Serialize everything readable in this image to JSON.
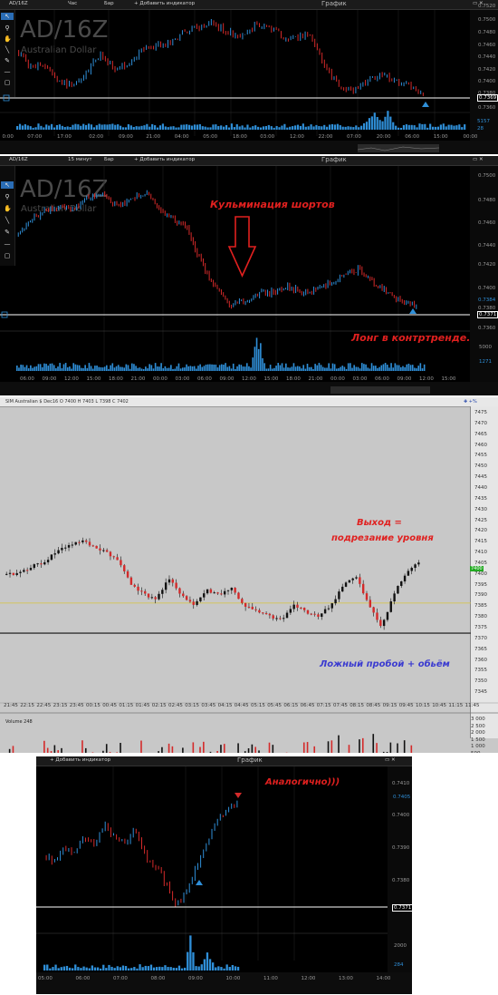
{
  "panel1": {
    "symbol_tab": "AD/16Z",
    "timeframe": "Час",
    "chart_type": "Бар",
    "add_indicator": "+ Добавить индикатор",
    "window_title": "График",
    "symbol_big": "AD/16Z",
    "instrument_name": "Australian Dollar",
    "price_axis": [
      "0.7520",
      "0.7500",
      "0.7480",
      "0.7460",
      "0.7440",
      "0.7420",
      "0.7400",
      "0.7380",
      "0.7369",
      "0.7360"
    ],
    "current_price": "0.7369",
    "volume_labels": [
      "5157",
      "28"
    ],
    "time_axis": [
      "0:00",
      "07:00",
      "17:00",
      "02:00",
      "09:00",
      "21:00",
      "04:00",
      "05:00",
      "18:00",
      "03:00",
      "12:00",
      "22:00",
      "07:00",
      "20:00",
      "06:00",
      "15:00",
      "00:00"
    ]
  },
  "panel2": {
    "symbol_tab": "AD/16Z",
    "timeframe": "15 минут",
    "chart_type": "Бар",
    "add_indicator": "+ Добавить индикатор",
    "window_title": "График",
    "symbol_big": "AD/16Z",
    "instrument_name": "Australian Dollar",
    "price_axis": [
      "0.7500",
      "0.7480",
      "0.7460",
      "0.7440",
      "0.7420",
      "0.7400",
      "0.7384",
      "0.7380",
      "0.7371",
      "0.7360"
    ],
    "current_price": "0.7371",
    "volume_labels": [
      "5000",
      "1271"
    ],
    "time_axis": [
      "06:00",
      "09:00",
      "12:00",
      "15:00",
      "18:00",
      "21:00",
      "00:00",
      "03:00",
      "06:00",
      "09:00",
      "12:00",
      "15:00",
      "18:00",
      "21:00",
      "00:00",
      "03:00",
      "06:00",
      "09:00",
      "12:00",
      "15:00"
    ],
    "annotation_top": "Кульминация шортов",
    "annotation_bottom": "Лонг в контртренде."
  },
  "panel3": {
    "header_text": "SIM Australian $ Dec16 O 7400 H 7403 L 7398 C 7402",
    "price_axis": [
      "7475",
      "7470",
      "7465",
      "7460",
      "7455",
      "7450",
      "7445",
      "7440",
      "7435",
      "7430",
      "7425",
      "7420",
      "7415",
      "7410",
      "7405",
      "7400",
      "7395",
      "7390",
      "7385",
      "7380",
      "7375",
      "7370",
      "7365",
      "7360",
      "7355",
      "7350",
      "7345"
    ],
    "current_price": "7400",
    "time_axis": [
      "21:45",
      "22:15",
      "22:45",
      "23:15",
      "23:45",
      "00:15",
      "00:45",
      "01:15",
      "01:45",
      "02:15",
      "02:45",
      "03:15",
      "03:45",
      "04:15",
      "04:45",
      "05:15",
      "05:45",
      "06:15",
      "06:45",
      "07:15",
      "07:45",
      "08:15",
      "08:45",
      "09:15",
      "09:45",
      "10:15",
      "10:45",
      "11:15",
      "11:45"
    ],
    "volume_label": "Volume 248",
    "volume_axis": [
      "3 000",
      "2 500",
      "2 000",
      "1 500",
      "1 000",
      "500"
    ],
    "annotation_exit_line1": "Выход =",
    "annotation_exit_line2": "подрезание уровня",
    "annotation_false": "Ложный пробой + обьём"
  },
  "panel4": {
    "add_indicator": "+ Добавить индикатор",
    "window_title": "График",
    "price_axis": [
      "0.7410",
      "0.7405",
      "0.7400",
      "0.7390",
      "0.7380",
      "0.7371"
    ],
    "current_price": "0.7405",
    "level_price": "0.7371",
    "volume_labels": [
      "2000",
      "284"
    ],
    "time_axis": [
      "05:00",
      "06:00",
      "07:00",
      "08:00",
      "09:00",
      "10:00",
      "11:00",
      "12:00",
      "13:00",
      "14:00"
    ],
    "annotation": "Аналогично)))"
  },
  "colors": {
    "bull": "#2f8fd8",
    "bear": "#d42a2a",
    "volume": "#2f8fd8",
    "annotation_red": "#e0201f",
    "annotation_blue": "#3b3bd0",
    "level_line": "#ffffff",
    "gray_bg": "#c8c8c8"
  },
  "icons": [
    "cursor-icon",
    "zoom-icon",
    "hand-icon",
    "line-icon",
    "pencil-icon",
    "horizontal-line-icon",
    "rectangle-icon"
  ]
}
